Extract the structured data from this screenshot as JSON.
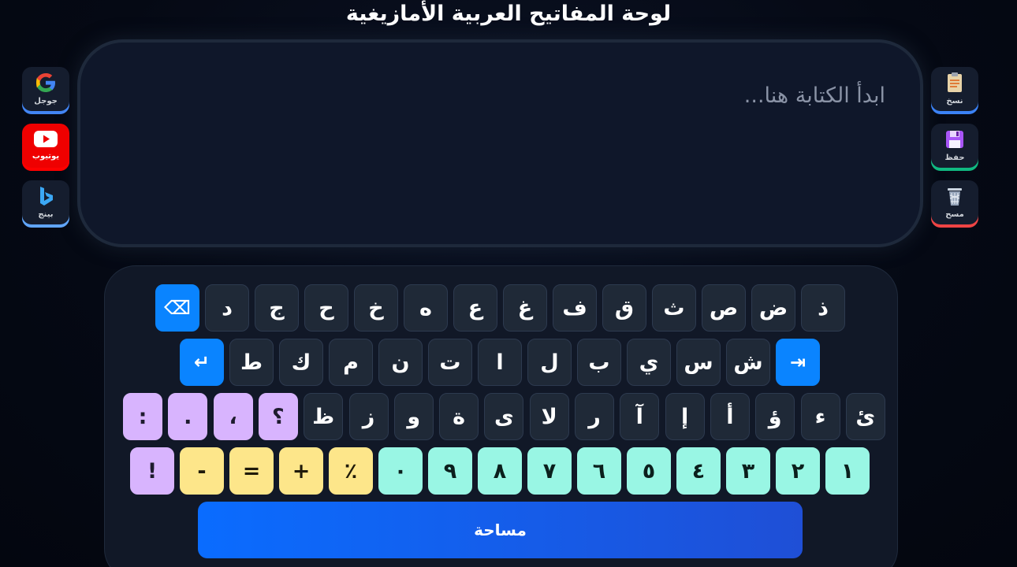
{
  "title": "لوحة المفاتيح العربية الأمازيغية",
  "editor": {
    "placeholder": "ابدأ الكتابة هنا..."
  },
  "left_tools": [
    {
      "label": "جوجل",
      "icon": "google-icon",
      "accent": "#4285f4"
    },
    {
      "label": "يوتيوب",
      "icon": "youtube-icon",
      "accent": "#ff0000"
    },
    {
      "label": "بينج",
      "icon": "bing-icon",
      "accent": "#60a5fa"
    }
  ],
  "right_tools": [
    {
      "label": "نسخ",
      "icon": "clipboard-icon",
      "accent": "#3b82f6"
    },
    {
      "label": "حفظ",
      "icon": "floppy-disk-icon",
      "accent": "#10b981"
    },
    {
      "label": "مسح",
      "icon": "trash-icon",
      "accent": "#ef4444"
    }
  ],
  "keyboard": {
    "rows": [
      [
        {
          "label": "⌫",
          "kind": "blue",
          "name": "backspace-key"
        },
        {
          "label": "د"
        },
        {
          "label": "ج"
        },
        {
          "label": "ح"
        },
        {
          "label": "خ"
        },
        {
          "label": "ه"
        },
        {
          "label": "ع"
        },
        {
          "label": "غ"
        },
        {
          "label": "ف"
        },
        {
          "label": "ق"
        },
        {
          "label": "ث"
        },
        {
          "label": "ص"
        },
        {
          "label": "ض"
        },
        {
          "label": "ذ"
        }
      ],
      [
        {
          "label": "↵",
          "kind": "blue",
          "name": "enter-key"
        },
        {
          "label": "ط"
        },
        {
          "label": "ك"
        },
        {
          "label": "م"
        },
        {
          "label": "ن"
        },
        {
          "label": "ت"
        },
        {
          "label": "ا"
        },
        {
          "label": "ل"
        },
        {
          "label": "ب"
        },
        {
          "label": "ي"
        },
        {
          "label": "س"
        },
        {
          "label": "ش"
        },
        {
          "label": "⇥",
          "kind": "blue",
          "name": "tab-key"
        }
      ],
      [
        {
          "label": ":",
          "kind": "purple"
        },
        {
          "label": ".",
          "kind": "purple"
        },
        {
          "label": "،",
          "kind": "purple"
        },
        {
          "label": "؟",
          "kind": "purple"
        },
        {
          "label": "ظ"
        },
        {
          "label": "ز"
        },
        {
          "label": "و"
        },
        {
          "label": "ة"
        },
        {
          "label": "ى"
        },
        {
          "label": "لا"
        },
        {
          "label": "ر"
        },
        {
          "label": "آ"
        },
        {
          "label": "إ"
        },
        {
          "label": "أ"
        },
        {
          "label": "ؤ"
        },
        {
          "label": "ء"
        },
        {
          "label": "ئ"
        }
      ],
      [
        {
          "label": "!",
          "kind": "purple"
        },
        {
          "label": "-",
          "kind": "yellow"
        },
        {
          "label": "=",
          "kind": "yellow"
        },
        {
          "label": "+",
          "kind": "yellow"
        },
        {
          "label": "٪",
          "kind": "yellow"
        },
        {
          "label": "٠",
          "kind": "teal"
        },
        {
          "label": "٩",
          "kind": "teal"
        },
        {
          "label": "٨",
          "kind": "teal"
        },
        {
          "label": "٧",
          "kind": "teal"
        },
        {
          "label": "٦",
          "kind": "teal"
        },
        {
          "label": "٥",
          "kind": "teal"
        },
        {
          "label": "٤",
          "kind": "teal"
        },
        {
          "label": "٣",
          "kind": "teal"
        },
        {
          "label": "٢",
          "kind": "teal"
        },
        {
          "label": "١",
          "kind": "teal"
        }
      ]
    ],
    "space_label": "مساحة"
  }
}
